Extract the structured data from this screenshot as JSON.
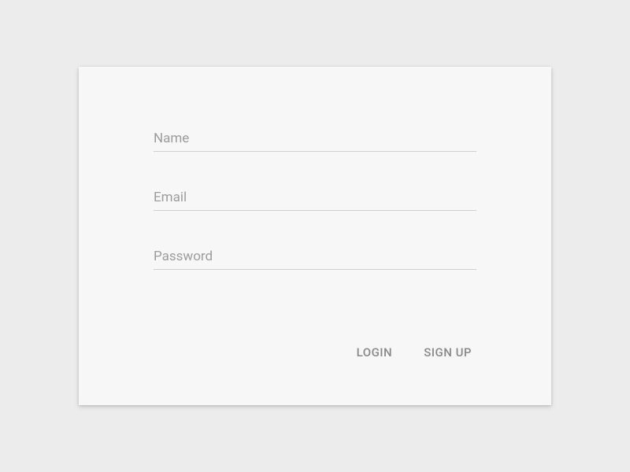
{
  "form": {
    "name": {
      "placeholder": "Name",
      "value": ""
    },
    "email": {
      "placeholder": "Email",
      "value": ""
    },
    "password": {
      "placeholder": "Password",
      "value": ""
    }
  },
  "actions": {
    "login": "LOGIN",
    "signup": "SIGN UP"
  }
}
